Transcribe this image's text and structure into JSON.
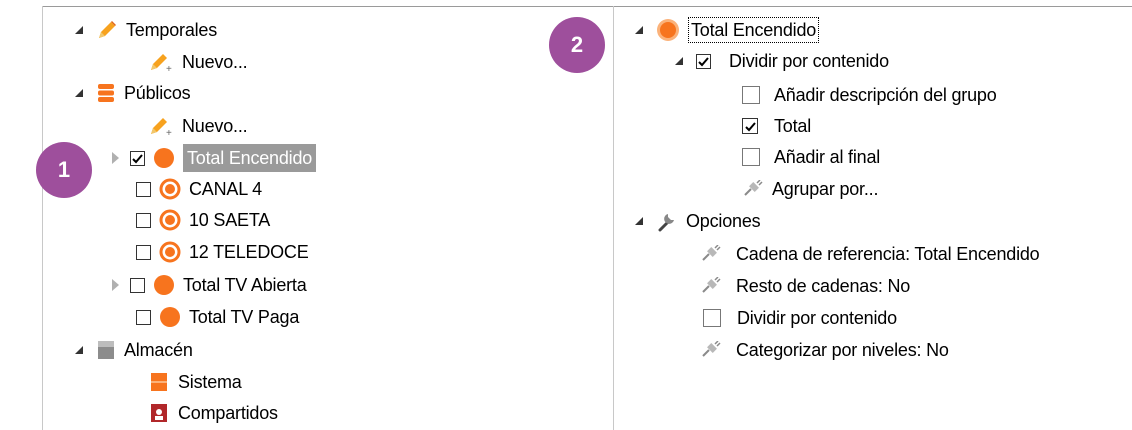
{
  "left_tree": {
    "temporales": {
      "label": "Temporales",
      "nuevo": "Nuevo..."
    },
    "publicos": {
      "label": "Públicos",
      "nuevo": "Nuevo...",
      "items": [
        {
          "label": "Total Encendido",
          "checked": true
        },
        {
          "label": "CANAL 4",
          "checked": false
        },
        {
          "label": "10 SAETA",
          "checked": false
        },
        {
          "label": "12 TELEDOCE",
          "checked": false
        },
        {
          "label": "Total TV Abierta",
          "checked": false
        },
        {
          "label": "Total TV Paga",
          "checked": false
        }
      ]
    },
    "almacen": {
      "label": "Almacén",
      "sistema": "Sistema",
      "compartidos": "Compartidos"
    }
  },
  "right_tree": {
    "root_label": "Total Encendido",
    "dividir": {
      "label": "Dividir por contenido",
      "checked": true,
      "children": [
        {
          "label": "Añadir descripción del grupo",
          "checked": false
        },
        {
          "label": "Total",
          "checked": true
        },
        {
          "label": "Añadir al final",
          "checked": false
        }
      ],
      "agrupar": "Agrupar por..."
    },
    "opciones": {
      "label": "Opciones",
      "cadena_ref": "Cadena de referencia: Total Encendido",
      "resto": "Resto de cadenas: No",
      "dividir": "Dividir por contenido",
      "categorizar": "Categorizar por niveles: No"
    }
  },
  "badges": {
    "one": "1",
    "two": "2"
  },
  "colors": {
    "orange": "#f7741e",
    "badge": "#9e4f9c",
    "selection": "#9a9a9a"
  }
}
